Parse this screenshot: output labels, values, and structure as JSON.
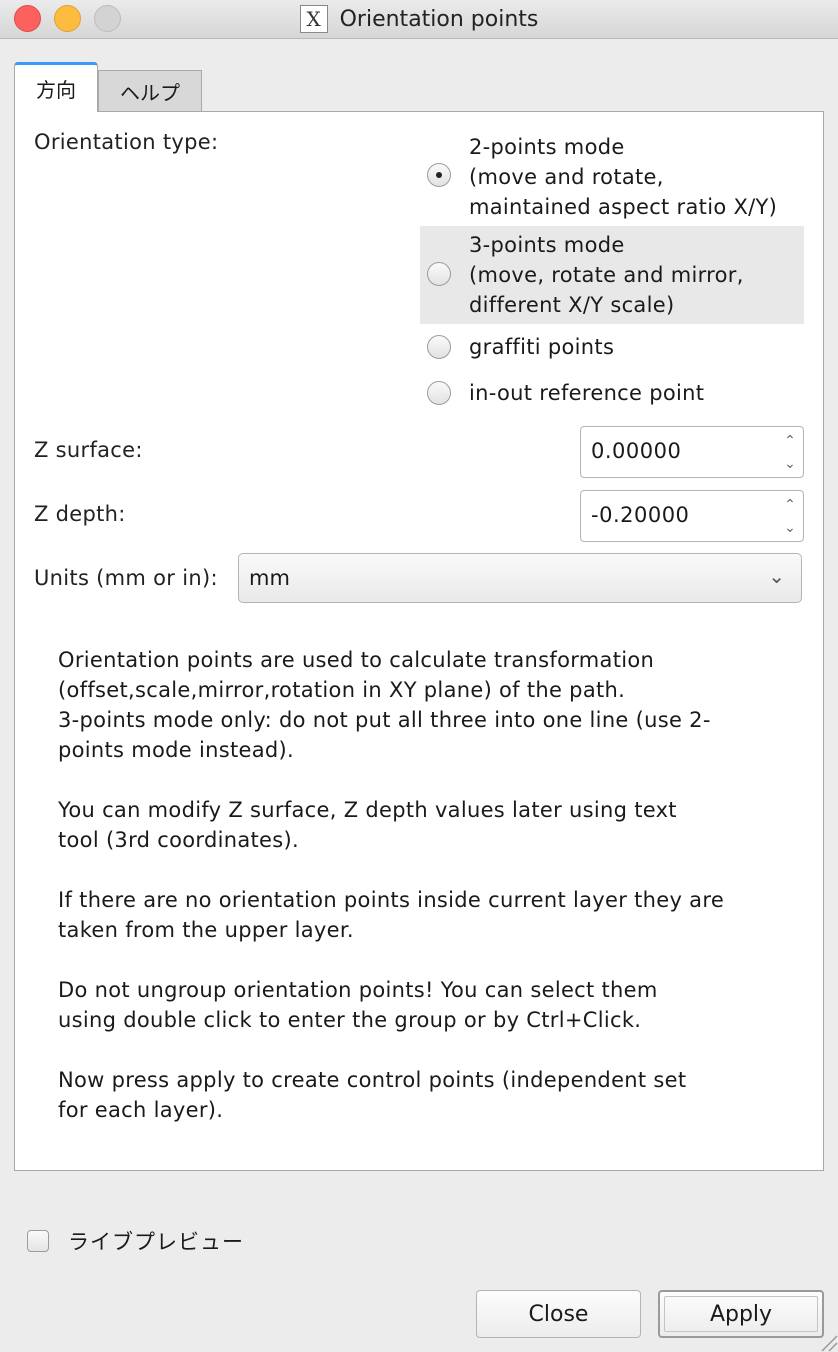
{
  "window": {
    "title": "Orientation points",
    "app_icon_letter": "X"
  },
  "tabs": [
    {
      "label": "方向"
    },
    {
      "label": "ヘルプ"
    }
  ],
  "form": {
    "orientation_type_label": "Orientation type:",
    "modes": [
      {
        "lines": [
          "2-points mode",
          "(move and rotate,",
          "maintained aspect ratio X/Y)"
        ],
        "checked": true
      },
      {
        "lines": [
          "3-points mode",
          "(move, rotate and mirror,",
          "different X/Y scale)"
        ],
        "checked": false
      },
      {
        "lines": [
          "graffiti points"
        ],
        "checked": false
      },
      {
        "lines": [
          "in-out reference point"
        ],
        "checked": false
      }
    ],
    "z_surface_label": "Z surface:",
    "z_surface_value": "0.00000",
    "z_depth_label": "Z depth:",
    "z_depth_value": "-0.20000",
    "units_label": "Units (mm or in):",
    "units_value": "mm"
  },
  "help_text": [
    [
      "Orientation points are used to calculate transformation",
      "(offset,scale,mirror,rotation in XY plane) of the path.",
      "3-points mode only: do not put all three into one line (use 2-",
      "points mode instead)."
    ],
    [
      "You can modify Z surface, Z depth values later using text",
      "tool (3rd coordinates)."
    ],
    [
      "If there are no orientation points inside current layer they are",
      "taken from the upper layer."
    ],
    [
      "Do not ungroup orientation points! You can select them",
      "using double click to enter the group or by Ctrl+Click."
    ],
    [
      "Now press apply to create control points (independent set",
      "for each layer)."
    ]
  ],
  "live_preview_label": "ライブプレビュー",
  "buttons": {
    "close": "Close",
    "apply": "Apply"
  }
}
